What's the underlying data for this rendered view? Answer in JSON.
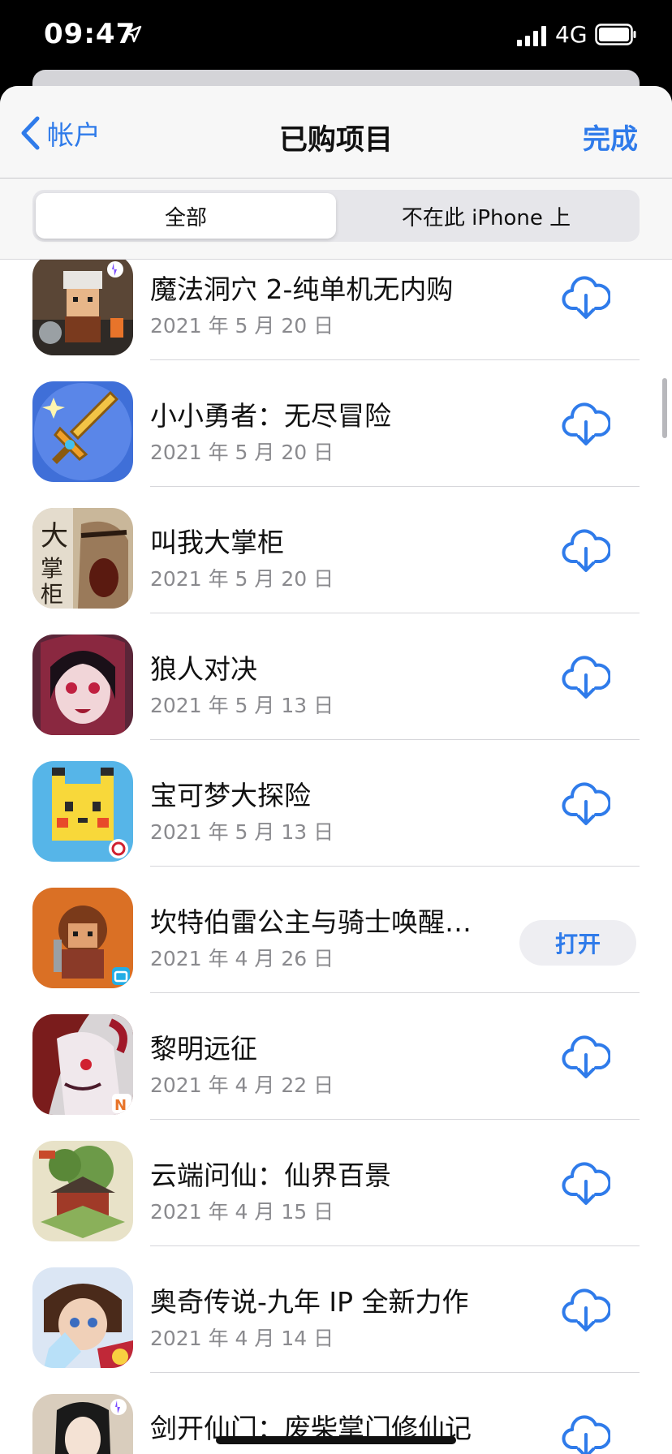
{
  "status_bar": {
    "time": "09:47",
    "network": "4G"
  },
  "nav": {
    "back_label": "帐户",
    "title": "已购项目",
    "done_label": "完成"
  },
  "segments": [
    {
      "label": "全部",
      "active": true
    },
    {
      "label": "不在此 iPhone 上",
      "active": false
    }
  ],
  "apps": [
    {
      "name": "魔法洞穴 2-纯单机无内购",
      "date": "2021 年 5 月 20 日",
      "action": "download",
      "icon": "magic-cave-icon",
      "icon_color": "#5a4636"
    },
    {
      "name": "小小勇者：无尽冒险",
      "date": "2021 年 5 月 20 日",
      "action": "download",
      "icon": "little-hero-sword-icon",
      "icon_color": "#3f6fd8"
    },
    {
      "name": "叫我大掌柜",
      "date": "2021 年 5 月 20 日",
      "action": "download",
      "icon": "shopkeeper-icon",
      "icon_color": "#c9b79a"
    },
    {
      "name": "狼人对决",
      "date": "2021 年 5 月 13 日",
      "action": "download",
      "icon": "werewolf-duel-icon",
      "icon_color": "#5a2538"
    },
    {
      "name": "宝可梦大探险",
      "date": "2021 年 5 月 13 日",
      "action": "download",
      "icon": "pokemon-quest-icon",
      "icon_color": "#56b5e8"
    },
    {
      "name": "坎特伯雷公主与骑士唤醒…",
      "date": "2021 年 4 月 26 日",
      "action": "open",
      "open_label": "打开",
      "icon": "canterbury-princess-icon",
      "icon_color": "#c84a1c"
    },
    {
      "name": "黎明远征",
      "date": "2021 年 4 月 22 日",
      "action": "download",
      "icon": "dawn-expedition-icon",
      "icon_color": "#7a1c1c"
    },
    {
      "name": "云端问仙：仙界百景",
      "date": "2021 年 4 月 15 日",
      "action": "download",
      "icon": "cloud-immortal-icon",
      "icon_color": "#6c9a48"
    },
    {
      "name": "奥奇传说-九年 IP 全新力作",
      "date": "2021 年 4 月 14 日",
      "action": "download",
      "icon": "aoqi-legend-icon",
      "icon_color": "#3a6cc0"
    },
    {
      "name": "剑开仙门：废柴掌门修仙记",
      "date": "",
      "action": "download",
      "icon": "sword-gate-icon",
      "icon_color": "#d9cdbd"
    }
  ],
  "colors": {
    "accent": "#2f7bea"
  }
}
